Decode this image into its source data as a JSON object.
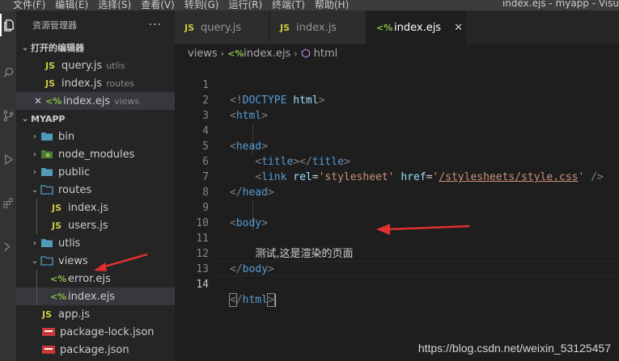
{
  "titlebar": {
    "menu": [
      "文件(F)",
      "编辑(E)",
      "选择(S)",
      "查看(V)",
      "转到(G)",
      "运行(R)",
      "终端(T)",
      "帮助(H)"
    ],
    "window_title": "index.ejs - myapp - Visu"
  },
  "sidebar": {
    "title": "资源管理器",
    "more": "···",
    "open_editors": {
      "header": "打开的编辑器",
      "items": [
        {
          "badge": "JS",
          "name": "query.js",
          "desc": "utlis"
        },
        {
          "badge": "JS",
          "name": "index.js",
          "desc": "routes"
        },
        {
          "close": "✕",
          "badge": "<%",
          "name": "index.ejs",
          "desc": "views"
        }
      ]
    },
    "project": {
      "header": "MYAPP",
      "items": [
        {
          "name": "bin"
        },
        {
          "name": "node_modules"
        },
        {
          "name": "public"
        },
        {
          "name": "routes"
        },
        {
          "badge": "JS",
          "name": "index.js"
        },
        {
          "badge": "JS",
          "name": "users.js"
        },
        {
          "name": "utlis"
        },
        {
          "name": "views"
        },
        {
          "badge": "<%",
          "name": "error.ejs"
        },
        {
          "badge": "<%",
          "name": "index.ejs"
        },
        {
          "badge": "JS",
          "name": "app.js"
        },
        {
          "name": "package-lock.json"
        },
        {
          "name": "package.json"
        }
      ]
    }
  },
  "tabs": [
    {
      "badge": "JS",
      "label": "query.js"
    },
    {
      "badge": "JS",
      "label": "index.js"
    },
    {
      "badge": "<%",
      "label": "index.ejs",
      "close": "✕"
    }
  ],
  "breadcrumb": {
    "folder": "views",
    "file_badge": "<%",
    "file": "index.ejs",
    "symbol": "html"
  },
  "editor": {
    "line_numbers": [
      "1",
      "2",
      "3",
      "4",
      "5",
      "6",
      "7",
      "8",
      "9",
      "10",
      "11",
      "12",
      "13",
      "14"
    ],
    "current_line": "14",
    "body_text": "测试,这是渲染的页面"
  },
  "watermark": "https://blog.csdn.net/weixin_53125457",
  "colors": {
    "accent_arrow": "#e03030",
    "js": "#cbcb41",
    "ejs": "#8dc149",
    "folder": "#519aba"
  }
}
